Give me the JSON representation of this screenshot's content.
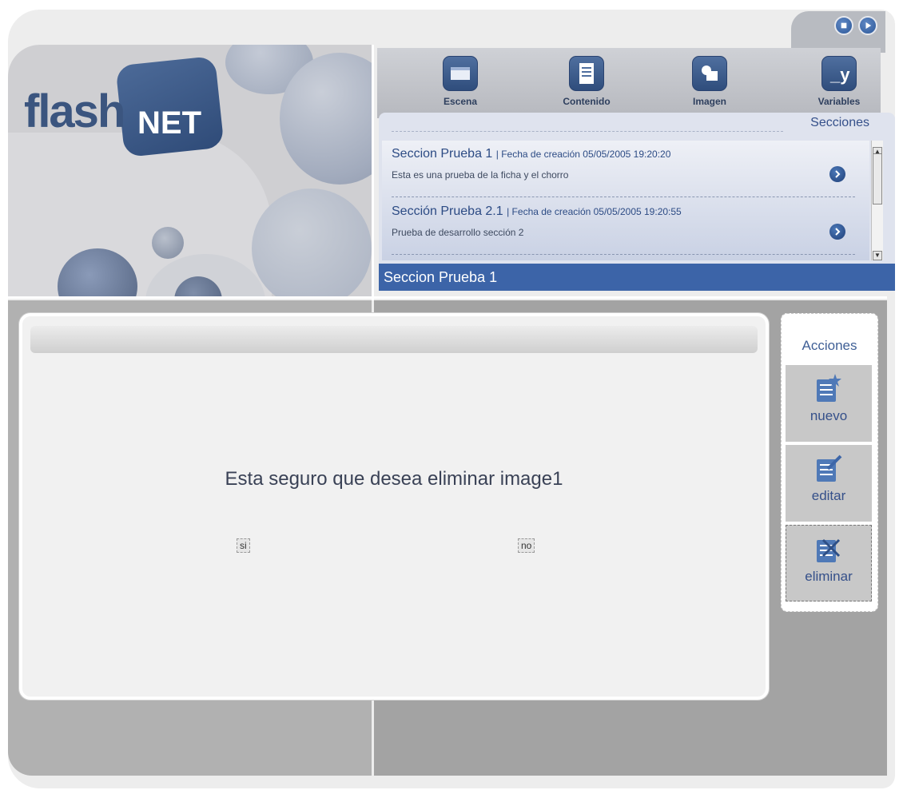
{
  "logo": {
    "text_flash": "flash",
    "text_net": "NET"
  },
  "toolbar": {
    "items": [
      {
        "label": "Escena",
        "icon": "scene-icon"
      },
      {
        "label": "Contenido",
        "icon": "content-icon"
      },
      {
        "label": "Imagen",
        "icon": "image-icon"
      },
      {
        "label": "Variables",
        "icon": "variables-icon"
      }
    ],
    "top_buttons": [
      {
        "icon": "stop-icon"
      },
      {
        "icon": "play-icon"
      }
    ]
  },
  "sections": {
    "title": "Secciones",
    "items": [
      {
        "name": "Seccion Prueba 1",
        "date": "| Fecha de creación 05/05/2005 19:20:20",
        "description": "Esta es una prueba de la ficha y el chorro"
      },
      {
        "name": "Sección Prueba 2.1",
        "date": "| Fecha de creación 05/05/2005 19:20:55",
        "description": "Prueba de desarrollo sección 2"
      }
    ],
    "selected": "Seccion Prueba 1"
  },
  "dialog": {
    "message": "Esta seguro que desea eliminar image1",
    "yes_label": "si",
    "no_label": "no"
  },
  "actions": {
    "title": "Acciones",
    "items": [
      {
        "label": "nuevo",
        "icon": "new-doc-icon"
      },
      {
        "label": "editar",
        "icon": "edit-doc-icon"
      },
      {
        "label": "eliminar",
        "icon": "delete-doc-icon"
      }
    ]
  },
  "colors": {
    "accent": "#3c64a8",
    "text_blue": "#2c4b84"
  }
}
